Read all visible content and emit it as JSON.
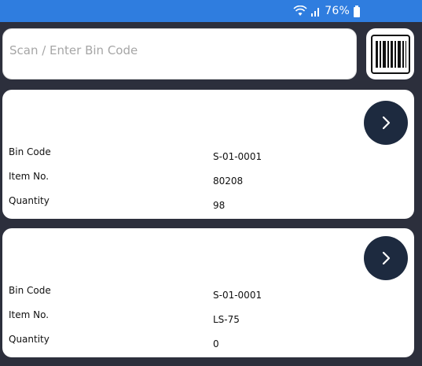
{
  "status_bar": {
    "battery_text": "76%",
    "wifi_icon": "wifi-icon",
    "signal_icon": "signal-icon",
    "battery_icon": "battery-icon",
    "background_color": "#2f7ddf"
  },
  "search": {
    "placeholder": "Scan / Enter Bin Code",
    "value": ""
  },
  "scan_button": {
    "icon": "barcode-icon"
  },
  "cards": [
    {
      "fields": [
        {
          "label": "Bin Code",
          "value": "S-01-0001"
        },
        {
          "label": "Item No.",
          "value": "80208"
        },
        {
          "label": "Quantity",
          "value": "98"
        }
      ],
      "action_icon": "chevron-right-icon"
    },
    {
      "fields": [
        {
          "label": "Bin Code",
          "value": "S-01-0001"
        },
        {
          "label": "Item No.",
          "value": "LS-75"
        },
        {
          "label": "Quantity",
          "value": "0"
        }
      ],
      "action_icon": "chevron-right-icon"
    }
  ],
  "colors": {
    "app_background": "#2c2f3c",
    "card_background": "#ffffff",
    "arrow_button": "#1d2a3f"
  }
}
